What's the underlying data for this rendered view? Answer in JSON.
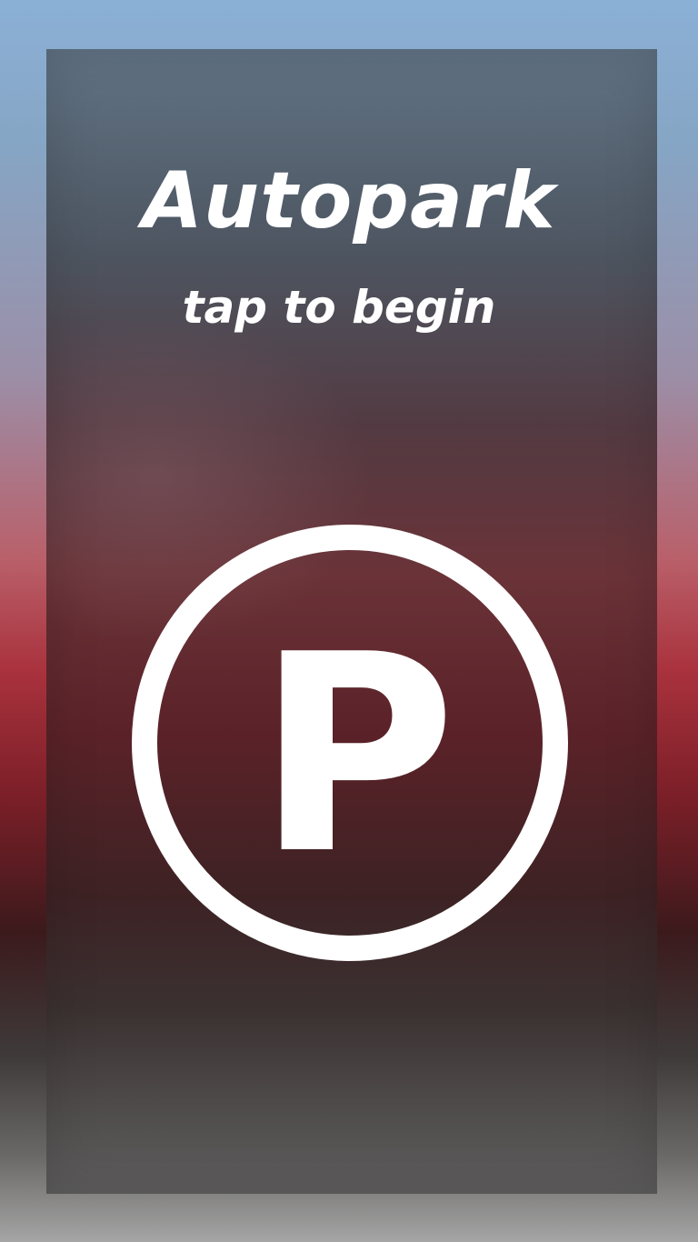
{
  "app": {
    "title": "Autopark",
    "subtitle": "tap to begin"
  },
  "start_button": {
    "icon": "parking-icon",
    "glyph": "P"
  },
  "colors": {
    "text": "#ffffff",
    "accent_red": "#a9323d",
    "top_blue": "#8bb0d6"
  }
}
